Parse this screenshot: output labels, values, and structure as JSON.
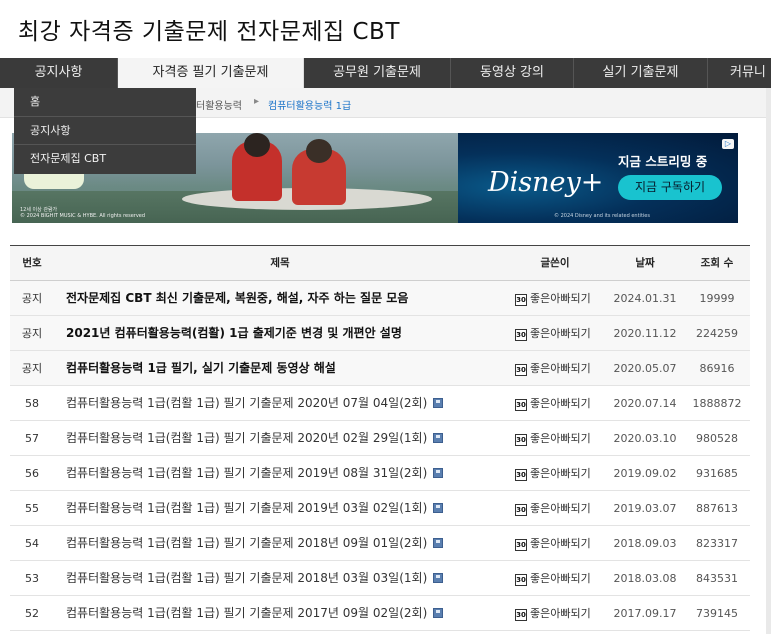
{
  "site": {
    "title": "최강 자격증 기출문제 전자문제집 CBT"
  },
  "nav": {
    "items": [
      {
        "label": "공지사항",
        "active": false
      },
      {
        "label": "자격증 필기 기출문제",
        "active": true
      },
      {
        "label": "공무원 기출문제",
        "active": false
      },
      {
        "label": "동영상 강의",
        "active": false
      },
      {
        "label": "실기 기출문제",
        "active": false
      },
      {
        "label": "커뮤니",
        "active": false
      }
    ]
  },
  "dropdown": {
    "items": [
      {
        "label": "홈"
      },
      {
        "label": "공지사항"
      },
      {
        "label": "전자문제집 CBT"
      }
    ]
  },
  "breadcrumb": {
    "partial": "터활용능력",
    "separator": "▸",
    "current": "컴퓨터활용능력 1급"
  },
  "ad": {
    "age_note": "12세 이상 관람가",
    "copyright_left": "© 2024 BIGHIT MUSIC & HYBE. All rights reserved",
    "brand": "Disney+",
    "headline": "지금 스트리밍 중",
    "cta": "지금 구독하기",
    "copyright_right": "© 2024 Disney and its related entities",
    "adchoice": "▷"
  },
  "board": {
    "headers": {
      "no": "번호",
      "title": "제목",
      "author": "글쓴이",
      "date": "날짜",
      "views": "조회 수"
    },
    "rows": [
      {
        "no": "공지",
        "title": "전자문제집 CBT 최신 기출문제, 복원중, 해설, 자주 하는 질문 모음",
        "badge": "30",
        "author": "좋은아빠되기",
        "date": "2024.01.31",
        "views": "19999",
        "notice": true
      },
      {
        "no": "공지",
        "title": "2021년 컴퓨터활용능력(컴활) 1급 출제기준 변경 및 개편안 설명",
        "badge": "30",
        "author": "좋은아빠되기",
        "date": "2020.11.12",
        "views": "224259",
        "notice": true
      },
      {
        "no": "공지",
        "title": "컴퓨터활용능력 1급 필기, 실기 기출문제 동영상 해설",
        "badge": "30",
        "author": "좋은아빠되기",
        "date": "2020.05.07",
        "views": "86916",
        "notice": true
      },
      {
        "no": "58",
        "title": "컴퓨터활용능력 1급(컴활 1급) 필기 기출문제 2020년 07월 04일(2회)",
        "badge": "30",
        "author": "좋은아빠되기",
        "date": "2020.07.14",
        "views": "1888872",
        "notice": false
      },
      {
        "no": "57",
        "title": "컴퓨터활용능력 1급(컴활 1급) 필기 기출문제 2020년 02월 29일(1회)",
        "badge": "30",
        "author": "좋은아빠되기",
        "date": "2020.03.10",
        "views": "980528",
        "notice": false
      },
      {
        "no": "56",
        "title": "컴퓨터활용능력 1급(컴활 1급) 필기 기출문제 2019년 08월 31일(2회)",
        "badge": "30",
        "author": "좋은아빠되기",
        "date": "2019.09.02",
        "views": "931685",
        "notice": false
      },
      {
        "no": "55",
        "title": "컴퓨터활용능력 1급(컴활 1급) 필기 기출문제 2019년 03월 02일(1회)",
        "badge": "30",
        "author": "좋은아빠되기",
        "date": "2019.03.07",
        "views": "887613",
        "notice": false
      },
      {
        "no": "54",
        "title": "컴퓨터활용능력 1급(컴활 1급) 필기 기출문제 2018년 09월 01일(2회)",
        "badge": "30",
        "author": "좋은아빠되기",
        "date": "2018.09.03",
        "views": "823317",
        "notice": false
      },
      {
        "no": "53",
        "title": "컴퓨터활용능력 1급(컴활 1급) 필기 기출문제 2018년 03월 03일(1회)",
        "badge": "30",
        "author": "좋은아빠되기",
        "date": "2018.03.08",
        "views": "843531",
        "notice": false
      },
      {
        "no": "52",
        "title": "컴퓨터활용능력 1급(컴활 1급) 필기 기출문제 2017년 09월 02일(2회)",
        "badge": "30",
        "author": "좋은아빠되기",
        "date": "2017.09.17",
        "views": "739145",
        "notice": false
      }
    ]
  }
}
